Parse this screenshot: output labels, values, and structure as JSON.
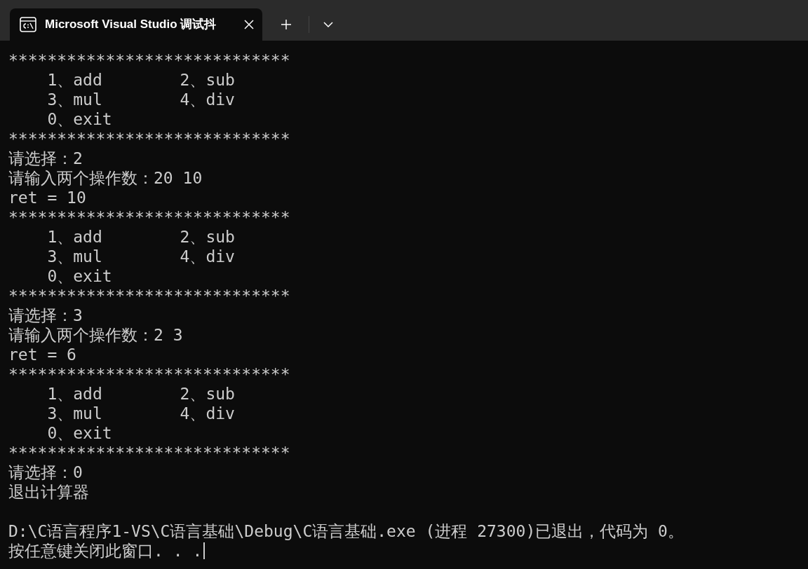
{
  "tab": {
    "title": "Microsoft Visual Studio 调试抖",
    "selected": true
  },
  "output": [
    "*****************************",
    "    1、add        2、sub",
    "    3、mul        4、div",
    "    0、exit",
    "*****************************",
    "请选择：2",
    "请输入两个操作数：20 10",
    "ret = 10",
    "*****************************",
    "    1、add        2、sub",
    "    3、mul        4、div",
    "    0、exit",
    "*****************************",
    "请选择：3",
    "请输入两个操作数：2 3",
    "ret = 6",
    "*****************************",
    "    1、add        2、sub",
    "    3、mul        4、div",
    "    0、exit",
    "*****************************",
    "请选择：0",
    "退出计算器"
  ],
  "exit_message": [
    "D:\\C语言程序1-VS\\C语言基础\\Debug\\C语言基础.exe (进程 27300)已退出，代码为 0。",
    "按任意键关闭此窗口. . ."
  ]
}
